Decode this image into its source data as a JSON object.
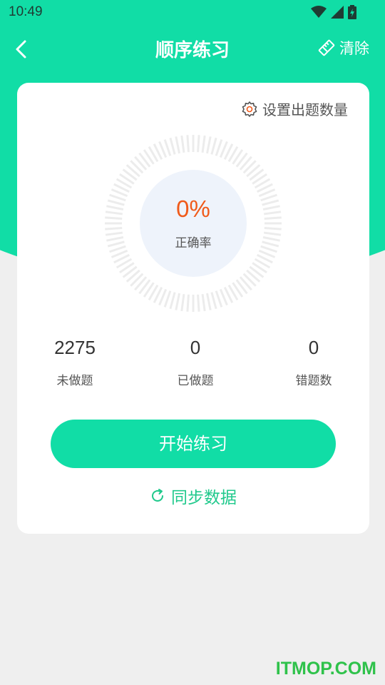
{
  "status_bar": {
    "time": "10:49",
    "icons": [
      "wifi-icon",
      "signal-icon",
      "battery-icon"
    ]
  },
  "nav": {
    "title": "顺序练习",
    "back_icon": "chevron-left-icon",
    "clear_label": "清除",
    "clear_icon": "eraser-icon"
  },
  "card": {
    "settings_label": "设置出题数量",
    "settings_icon": "gear-icon",
    "accuracy": {
      "value": "0%",
      "label": "正确率"
    },
    "stats": [
      {
        "value": "2275",
        "label": "未做题"
      },
      {
        "value": "0",
        "label": "已做题"
      },
      {
        "value": "0",
        "label": "错题数"
      }
    ],
    "start_button": "开始练习",
    "sync_label": "同步数据",
    "sync_icon": "refresh-icon"
  },
  "watermark": "ITMOP.COM",
  "colors": {
    "brand": "#11dda6",
    "accuracy": "#f05a1a",
    "sync": "#20c98c"
  }
}
